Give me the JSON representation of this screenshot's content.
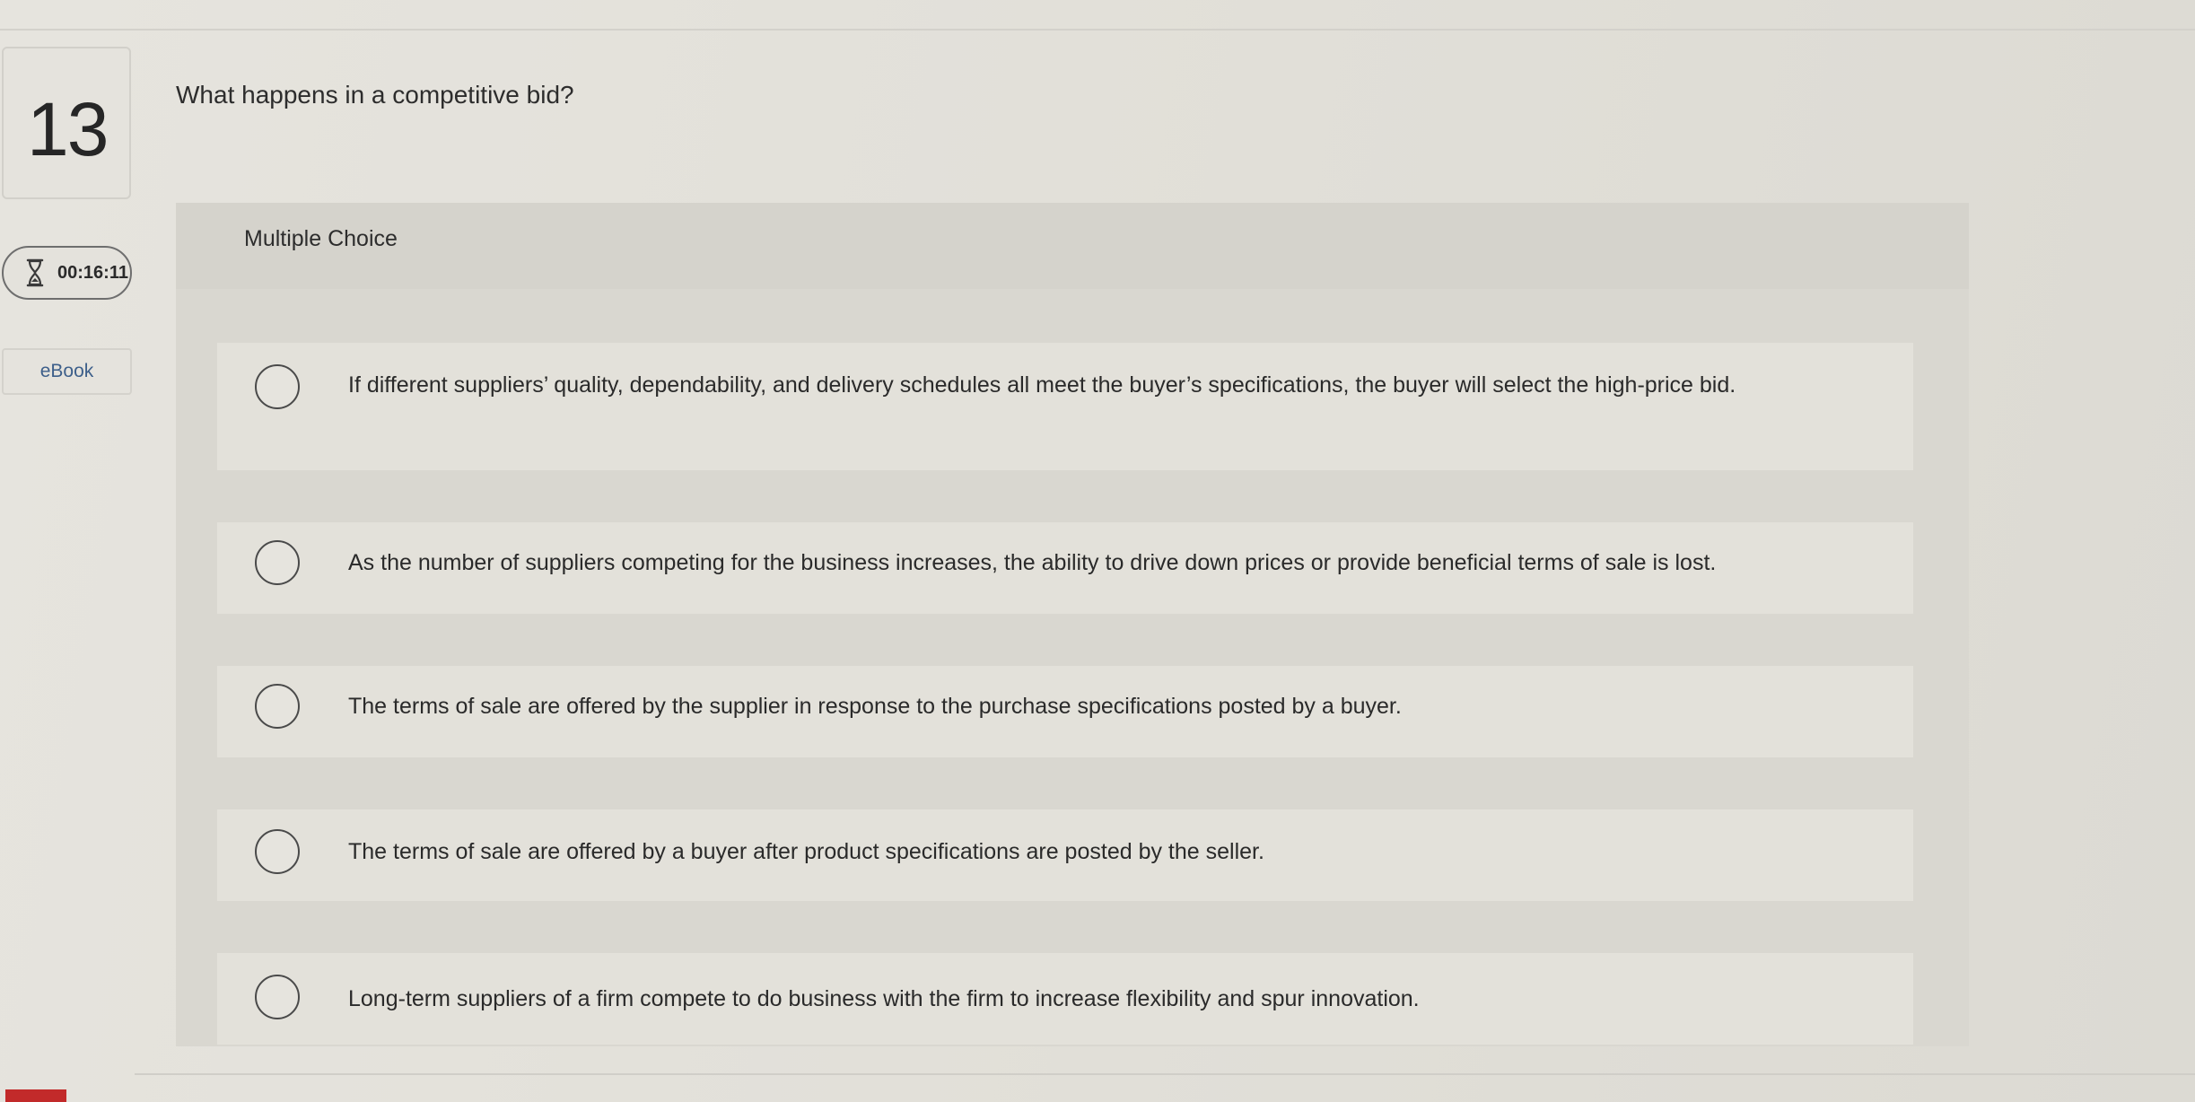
{
  "question": {
    "number": "13",
    "text": "What happens in a competitive bid?",
    "type_label": "Multiple Choice"
  },
  "timer": {
    "icon": "hourglass-icon",
    "value": "00:16:11"
  },
  "ebook": {
    "label": "eBook"
  },
  "options": [
    {
      "text": "If different suppliers’ quality, dependability, and delivery schedules all meet the buyer’s specifications, the buyer will select the high-price bid."
    },
    {
      "text": "As the number of suppliers competing for the business increases, the ability to drive down prices or provide beneficial terms of sale is lost."
    },
    {
      "text": "The terms of sale are offered by the supplier in response to the purchase specifications posted by a buyer."
    },
    {
      "text": "The terms of sale are offered by a buyer after product specifications are posted by the seller."
    },
    {
      "text": "Long-term suppliers of a firm compete to do business with the firm to increase flexibility and spur innovation."
    }
  ],
  "colors": {
    "link": "#3d5f8a",
    "brand_red": "#c22a2a"
  }
}
